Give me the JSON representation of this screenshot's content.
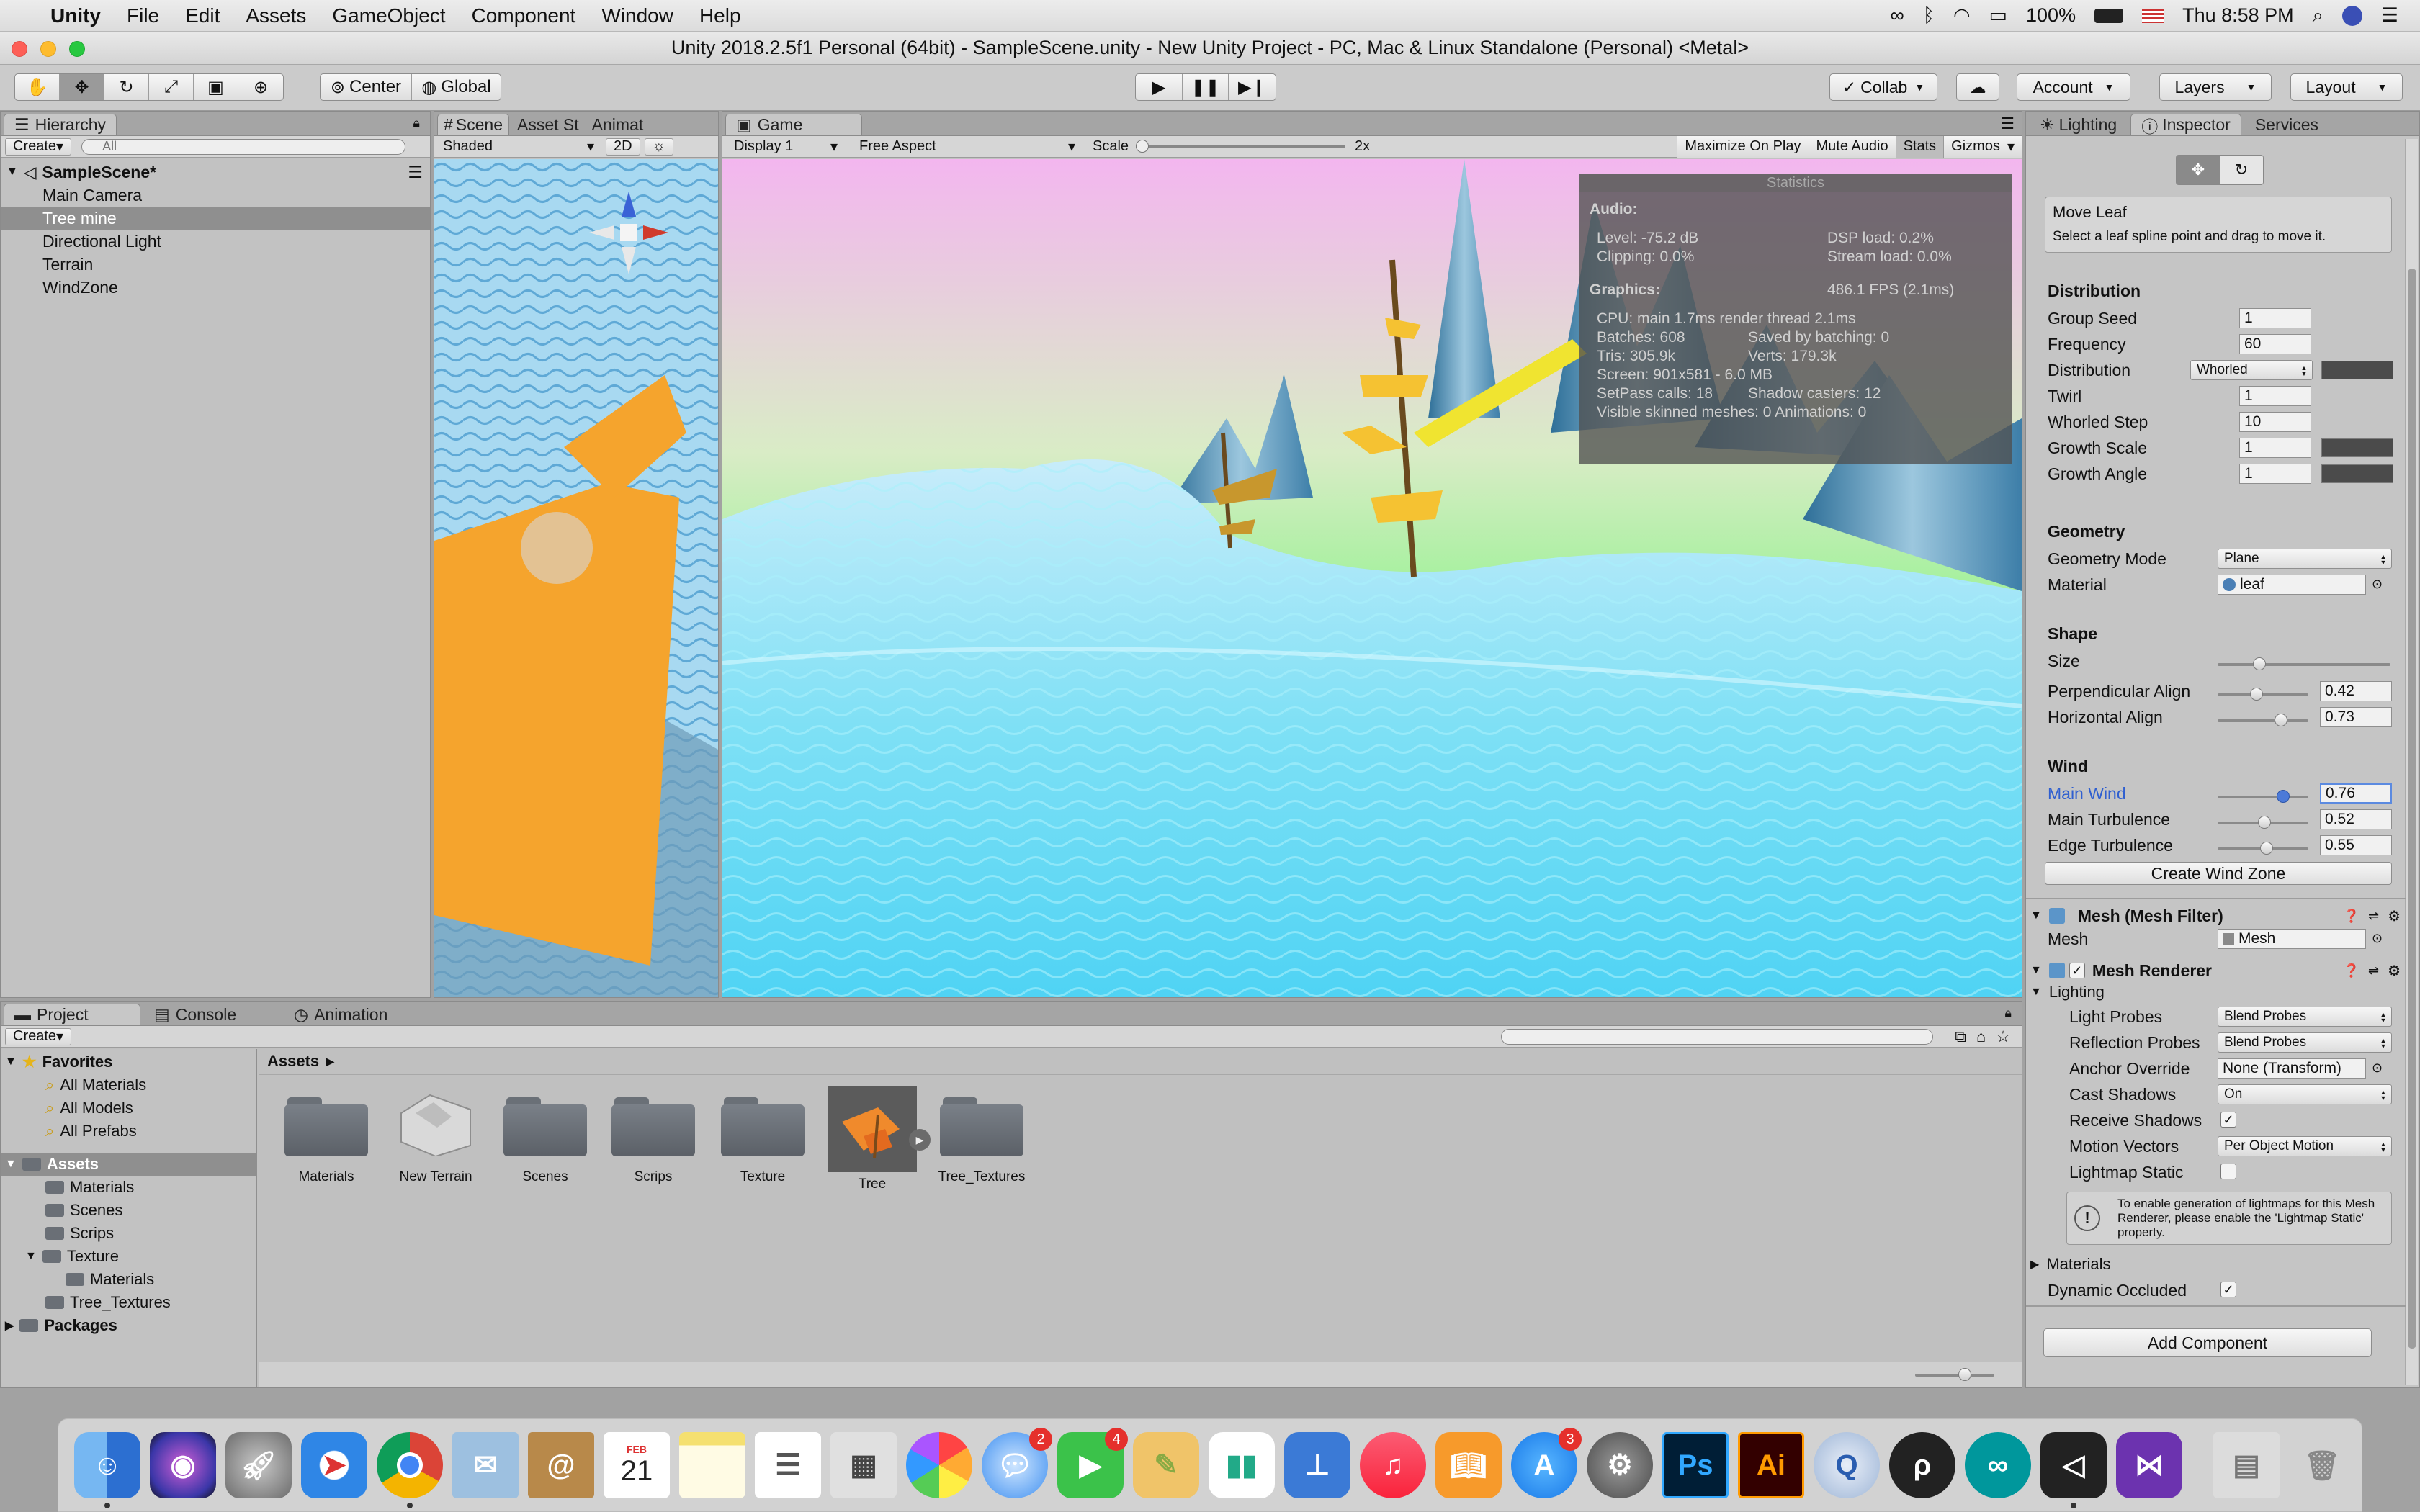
{
  "menubar": {
    "app": "Unity",
    "items": [
      "File",
      "Edit",
      "Assets",
      "GameObject",
      "Component",
      "Window",
      "Help"
    ],
    "battery": "100%",
    "clock": "Thu 8:58 PM"
  },
  "window": {
    "title": "Unity 2018.2.5f1 Personal (64bit) - SampleScene.unity - New Unity Project - PC, Mac & Linux Standalone (Personal) <Metal>"
  },
  "toolbar": {
    "pivot": "Center",
    "space": "Global",
    "collab": "Collab",
    "account": "Account",
    "layers": "Layers",
    "layout": "Layout"
  },
  "hierarchy": {
    "tab": "Hierarchy",
    "create": "Create",
    "search_placeholder": "All",
    "scene": "SampleScene*",
    "items": [
      "Main Camera",
      "Tree mine",
      "Directional Light",
      "Terrain",
      "WindZone"
    ]
  },
  "scene": {
    "tabs": [
      "Scene",
      "Asset St",
      "Animat"
    ],
    "shading": "Shaded",
    "mode2d": "2D"
  },
  "game": {
    "tab": "Game",
    "display": "Display 1",
    "aspect": "Free Aspect",
    "scale_label": "Scale",
    "scale_value": "2x",
    "buttons": [
      "Maximize On Play",
      "Mute Audio",
      "Stats",
      "Gizmos"
    ]
  },
  "stats": {
    "title": "Statistics",
    "audio_header": "Audio:",
    "level": "Level: -75.2 dB",
    "clipping": "Clipping: 0.0%",
    "dsp": "DSP load: 0.2%",
    "stream": "Stream load: 0.0%",
    "graphics_header": "Graphics:",
    "fps": "486.1 FPS (2.1ms)",
    "cpu": "CPU: main 1.7ms  render thread 2.1ms",
    "batches": "Batches: 608",
    "saved": "Saved by batching: 0",
    "tris": "Tris: 305.9k",
    "verts": "Verts: 179.3k",
    "screen": "Screen: 901x581 - 6.0 MB",
    "setpass": "SetPass calls: 18",
    "shadow": "Shadow casters: 12",
    "skinned": "Visible skinned meshes: 0  Animations: 0"
  },
  "inspector": {
    "tabs": [
      "Lighting",
      "Inspector",
      "Services"
    ],
    "help_title": "Move Leaf",
    "help_text": "Select a leaf spline point and drag to move it.",
    "distribution_header": "Distribution",
    "group_seed_label": "Group Seed",
    "group_seed": "1",
    "frequency_label": "Frequency",
    "frequency": "60",
    "distribution_label": "Distribution",
    "distribution": "Whorled",
    "twirl_label": "Twirl",
    "twirl": "1",
    "whorled_step_label": "Whorled Step",
    "whorled_step": "10",
    "growth_scale_label": "Growth Scale",
    "growth_scale": "1",
    "growth_angle_label": "Growth Angle",
    "growth_angle": "1",
    "geometry_header": "Geometry",
    "geometry_mode_label": "Geometry Mode",
    "geometry_mode": "Plane",
    "material_label": "Material",
    "material": "leaf",
    "shape_header": "Shape",
    "size_label": "Size",
    "size_slider": 0.22,
    "perp_label": "Perpendicular Align",
    "perp": "0.42",
    "horiz_label": "Horizontal Align",
    "horiz": "0.73",
    "wind_header": "Wind",
    "main_wind_label": "Main Wind",
    "main_wind": "0.76",
    "main_turb_label": "Main Turbulence",
    "main_turb": "0.52",
    "edge_turb_label": "Edge Turbulence",
    "edge_turb": "0.55",
    "create_wind": "Create Wind Zone",
    "mesh_filter_header": "Mesh (Mesh Filter)",
    "mesh_label": "Mesh",
    "mesh": "Mesh",
    "mesh_renderer_header": "Mesh Renderer",
    "lighting_label": "Lighting",
    "light_probes_label": "Light Probes",
    "light_probes": "Blend Probes",
    "refl_probes_label": "Reflection Probes",
    "refl_probes": "Blend Probes",
    "anchor_label": "Anchor Override",
    "anchor": "None (Transform)",
    "cast_label": "Cast Shadows",
    "cast": "On",
    "receive_label": "Receive Shadows",
    "motion_label": "Motion Vectors",
    "motion": "Per Object Motion",
    "lightmap_label": "Lightmap Static",
    "lightmap_info": "To enable generation of lightmaps for this Mesh Renderer, please enable the 'Lightmap Static' property.",
    "materials_label": "Materials",
    "dynamic_label": "Dynamic Occluded",
    "add_component": "Add Component"
  },
  "project": {
    "tabs": [
      "Project",
      "Console",
      "Animation"
    ],
    "create": "Create",
    "favorites": "Favorites",
    "fav_items": [
      "All Materials",
      "All Models",
      "All Prefabs"
    ],
    "assets_root": "Assets",
    "tree": [
      "Materials",
      "Scenes",
      "Scrips",
      "Texture",
      "Materials",
      "Tree_Textures"
    ],
    "packages": "Packages",
    "breadcrumb": "Assets",
    "assets": [
      "Materials",
      "New Terrain",
      "Scenes",
      "Scrips",
      "Texture",
      "Tree",
      "Tree_Textures"
    ]
  },
  "dock": {
    "calendar_month": "FEB",
    "calendar_day": "21",
    "messages_badge": "2",
    "facetime_badge": "4",
    "appstore_badge": "3",
    "ps": "Ps",
    "ai": "Ai"
  },
  "colors": {
    "accent_blue": "#2f5fd0",
    "tree_orange": "#f5a42d",
    "selection_gray": "#8f8f8f"
  }
}
